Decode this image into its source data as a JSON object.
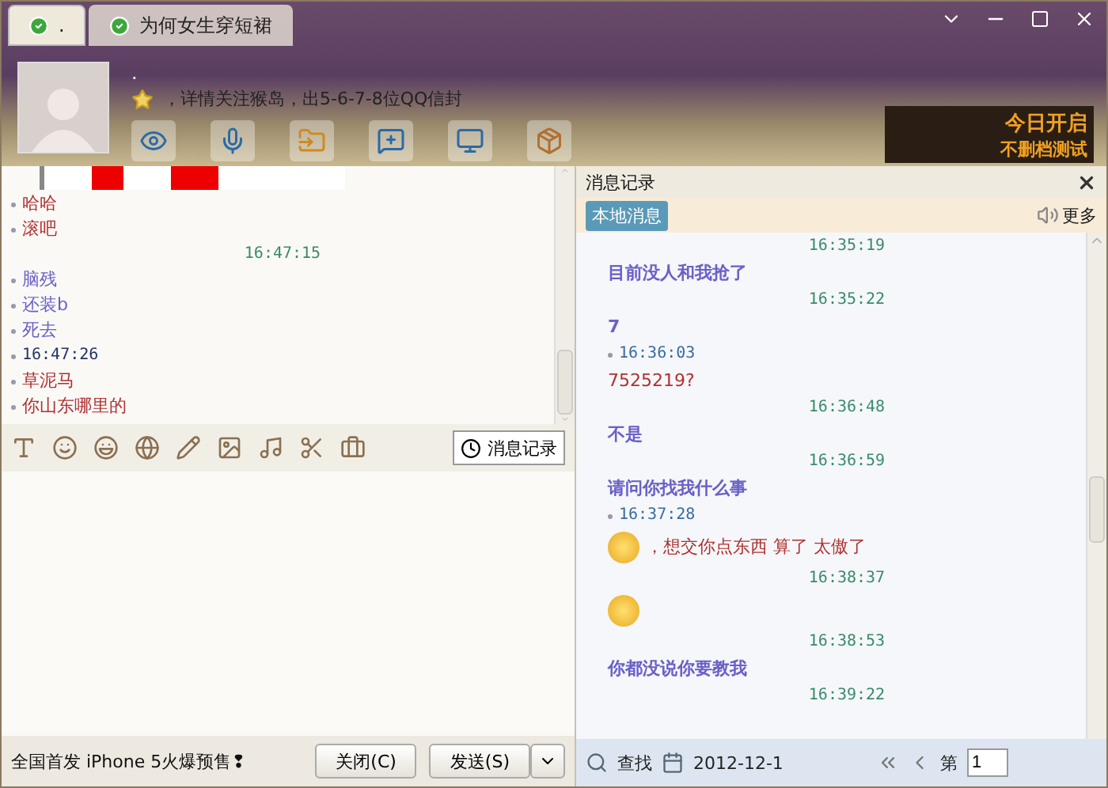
{
  "tabs": [
    {
      "label": ".",
      "selected": true
    },
    {
      "label": "为何女生穿短裙",
      "selected": false
    }
  ],
  "contact": {
    "name": ".",
    "signature": "，详情关注猴岛，出5-6-7-8位QQ信封"
  },
  "ad_banner": {
    "line_1": "今日开启",
    "line_2": "不删档测试"
  },
  "chat": [
    {
      "kind": "image"
    },
    {
      "kind": "text",
      "self": true,
      "text": "哈哈"
    },
    {
      "kind": "text",
      "self": true,
      "text": "滚吧"
    },
    {
      "kind": "time",
      "self": false,
      "text": "16:47:15"
    },
    {
      "kind": "text",
      "self": false,
      "text": "脑残"
    },
    {
      "kind": "text",
      "self": false,
      "text": "还装b"
    },
    {
      "kind": "text",
      "self": false,
      "text": "死去"
    },
    {
      "kind": "time",
      "self": true,
      "text": "16:47:26"
    },
    {
      "kind": "text",
      "self": true,
      "text": "草泥马"
    },
    {
      "kind": "text",
      "self": true,
      "text": "你山东哪里的"
    }
  ],
  "history_button": "消息记录",
  "promo": "全国首发 iPhone 5火爆预售❢",
  "close_button": "关闭(C)",
  "send_button": "发送(S)",
  "history": {
    "title": "消息记录",
    "tab": "本地消息",
    "more": "更多",
    "entries": [
      {
        "kind": "time",
        "self": false,
        "text": "16:35:19"
      },
      {
        "kind": "text",
        "self": false,
        "text": "目前没人和我抢了"
      },
      {
        "kind": "time",
        "self": false,
        "text": "16:35:22"
      },
      {
        "kind": "text",
        "self": false,
        "text": "7"
      },
      {
        "kind": "time",
        "self": true,
        "text": "16:36:03"
      },
      {
        "kind": "text",
        "self": true,
        "text": "7525219?"
      },
      {
        "kind": "time",
        "self": false,
        "text": "16:36:48"
      },
      {
        "kind": "text",
        "self": false,
        "text": "不是"
      },
      {
        "kind": "time",
        "self": false,
        "text": "16:36:59"
      },
      {
        "kind": "text",
        "self": false,
        "text": "请问你找我什么事"
      },
      {
        "kind": "time",
        "self": true,
        "text": "16:37:28"
      },
      {
        "kind": "emoji_text",
        "self": true,
        "text": "，想交你点东西  算了  太傲了"
      },
      {
        "kind": "time",
        "self": false,
        "text": "16:38:37"
      },
      {
        "kind": "emoji",
        "self": false
      },
      {
        "kind": "time",
        "self": false,
        "text": "16:38:53"
      },
      {
        "kind": "text",
        "self": false,
        "text": "你都没说你要教我"
      },
      {
        "kind": "time",
        "self": false,
        "text": "16:39:22"
      }
    ],
    "search": "查找",
    "date": "2012-12-1",
    "page_label": "第",
    "page": "1"
  }
}
